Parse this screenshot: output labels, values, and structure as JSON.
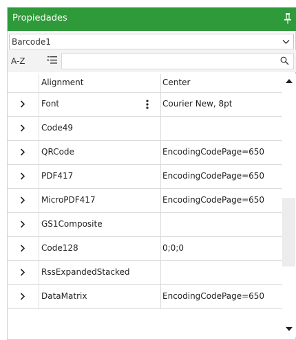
{
  "header": {
    "title": "Propiedades"
  },
  "selector": {
    "value": "Barcode1"
  },
  "toolbar": {
    "az_label": "A-Z",
    "search_placeholder": ""
  },
  "properties": [
    {
      "name": "Alignment",
      "value": "Center",
      "expandable": false
    },
    {
      "name": "Font",
      "value": "Courier New, 8pt",
      "expandable": true,
      "has_menu": true
    },
    {
      "name": "Code49",
      "value": "",
      "expandable": true
    },
    {
      "name": "QRCode",
      "value": "EncodingCodePage=650",
      "expandable": true
    },
    {
      "name": "PDF417",
      "value": "EncodingCodePage=650",
      "expandable": true
    },
    {
      "name": "MicroPDF417",
      "value": "EncodingCodePage=650",
      "expandable": true
    },
    {
      "name": "GS1Composite",
      "value": "",
      "expandable": true
    },
    {
      "name": "Code128",
      "value": "0;0;0",
      "expandable": true
    },
    {
      "name": "RssExpandedStacked",
      "value": "",
      "expandable": true
    },
    {
      "name": "DataMatrix",
      "value": "EncodingCodePage=650",
      "expandable": true
    }
  ],
  "colors": {
    "header_bg": "#2e9a3a",
    "header_text": "#ffffff",
    "grid_line": "#dcdcdc"
  }
}
